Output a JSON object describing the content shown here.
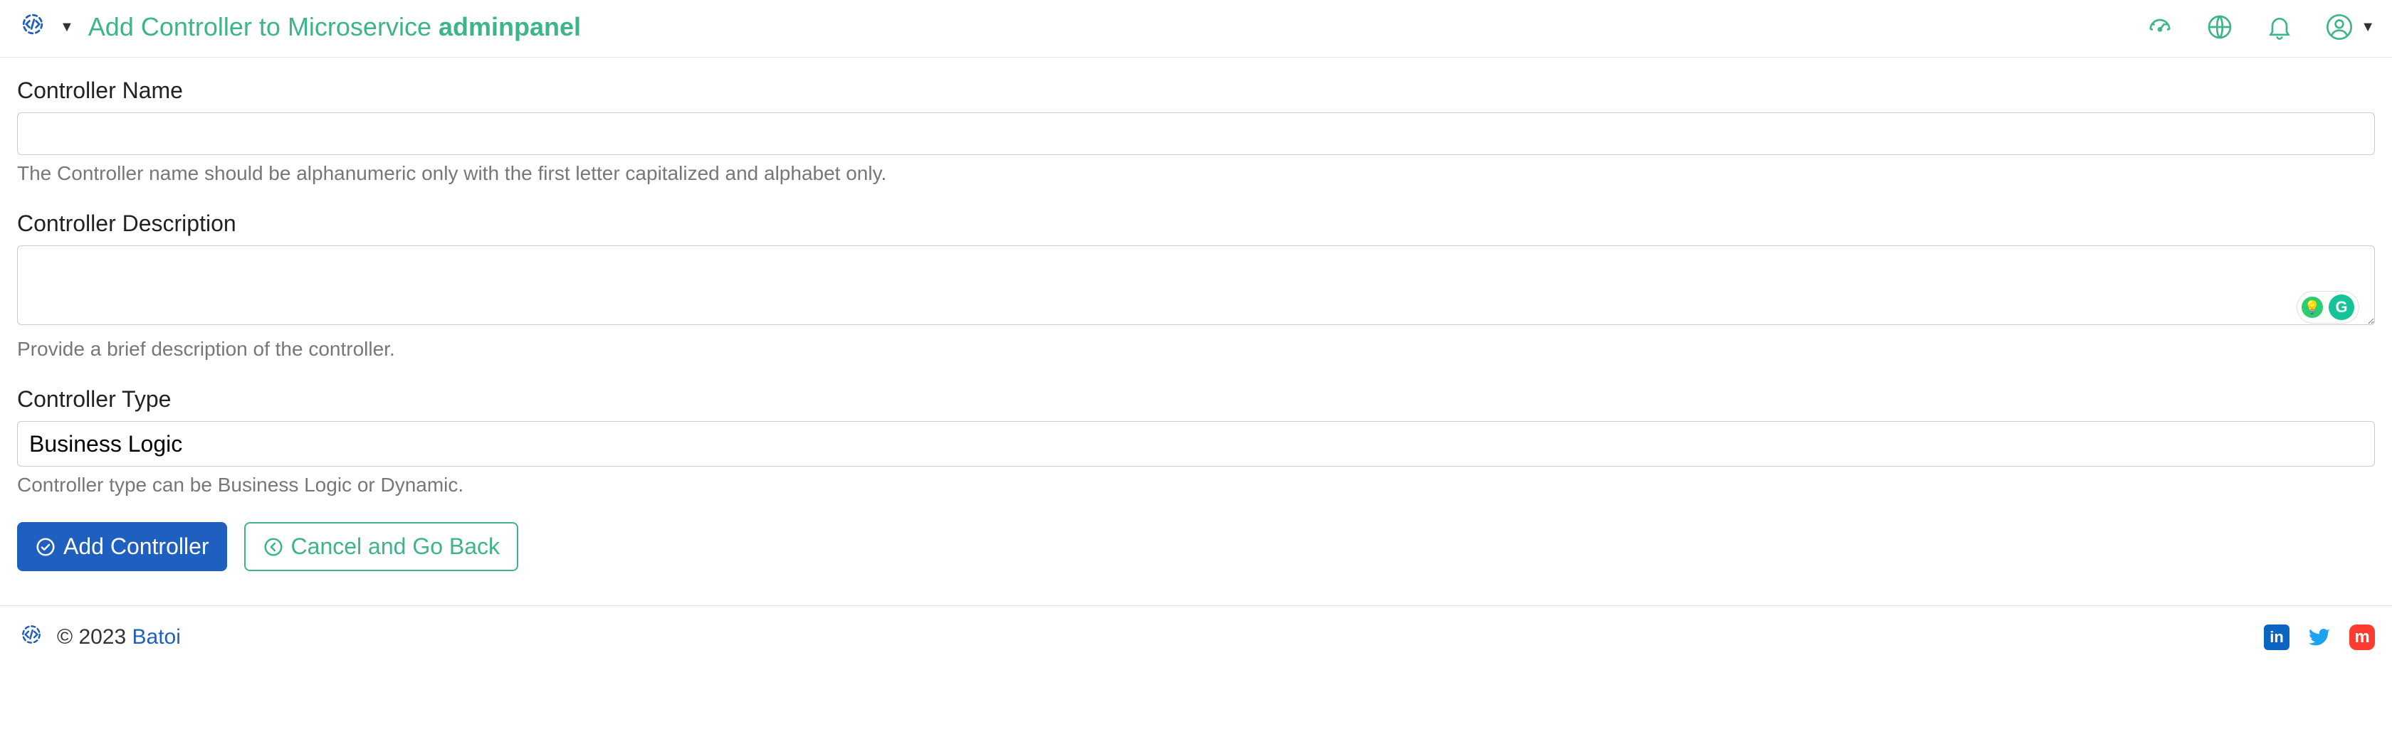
{
  "header": {
    "title_prefix": "Add Controller to Microservice ",
    "title_bold": "adminpanel"
  },
  "form": {
    "name": {
      "label": "Controller Name",
      "value": "",
      "help": "The Controller name should be alphanumeric only with the first letter capitalized and alphabet only."
    },
    "description": {
      "label": "Controller Description",
      "value": "",
      "help": "Provide a brief description of the controller."
    },
    "type": {
      "label": "Controller Type",
      "selected": "Business Logic",
      "help": "Controller type can be Business Logic or Dynamic."
    }
  },
  "buttons": {
    "submit": "Add Controller",
    "cancel": "Cancel and Go Back"
  },
  "footer": {
    "copyright": "© 2023 ",
    "brand": "Batoi"
  }
}
